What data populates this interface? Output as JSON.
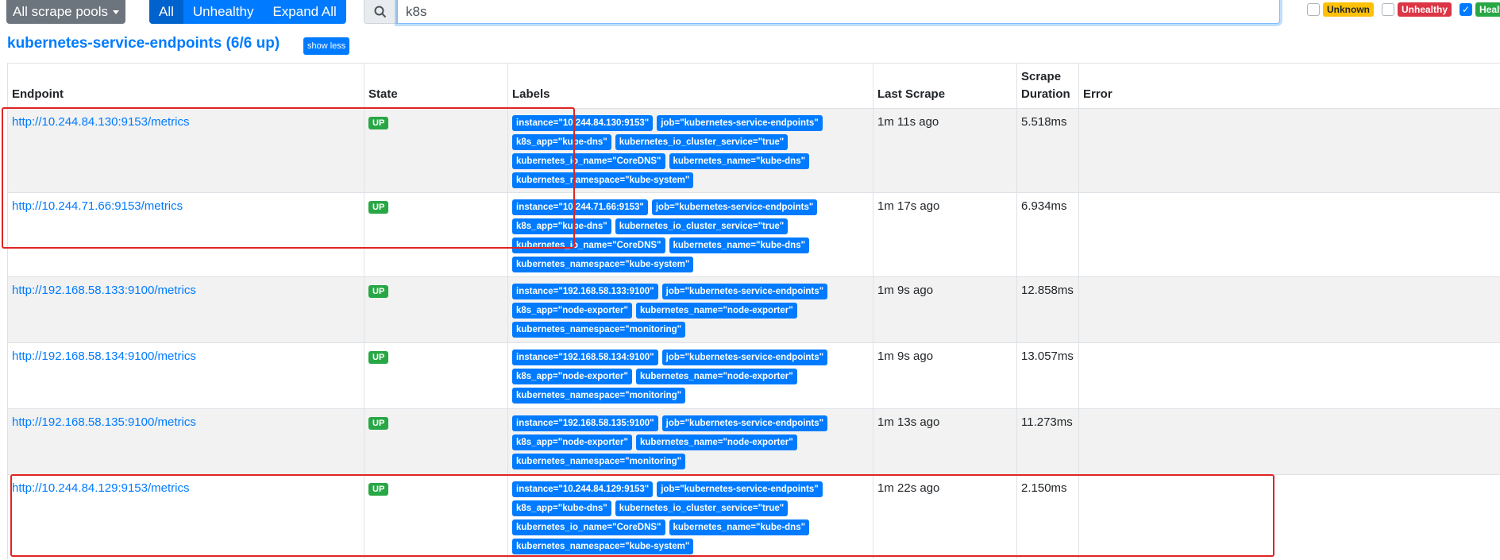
{
  "toolbar": {
    "pool_selector": "All scrape pools",
    "filter_all": "All",
    "filter_unhealthy": "Unhealthy",
    "expand_all": "Expand All",
    "search_value": "k8s"
  },
  "health_filters": {
    "unknown": "Unknown",
    "unhealthy": "Unhealthy",
    "healthy": "Healthy"
  },
  "pool": {
    "title": "kubernetes-service-endpoints (6/6 up)",
    "show_less": "show less"
  },
  "table": {
    "headers": {
      "endpoint": "Endpoint",
      "state": "State",
      "labels": "Labels",
      "last_scrape": "Last Scrape",
      "scrape_duration": "Scrape Duration",
      "error": "Error"
    },
    "rows": [
      {
        "endpoint": "http://10.244.84.130:9153/metrics",
        "state": "UP",
        "labels": [
          "instance=\"10.244.84.130:9153\"",
          "job=\"kubernetes-service-endpoints\"",
          "k8s_app=\"kube-dns\"",
          "kubernetes_io_cluster_service=\"true\"",
          "kubernetes_io_name=\"CoreDNS\"",
          "kubernetes_name=\"kube-dns\"",
          "kubernetes_namespace=\"kube-system\""
        ],
        "last_scrape": "1m 11s ago",
        "duration": "5.518ms",
        "error": ""
      },
      {
        "endpoint": "http://10.244.71.66:9153/metrics",
        "state": "UP",
        "labels": [
          "instance=\"10.244.71.66:9153\"",
          "job=\"kubernetes-service-endpoints\"",
          "k8s_app=\"kube-dns\"",
          "kubernetes_io_cluster_service=\"true\"",
          "kubernetes_io_name=\"CoreDNS\"",
          "kubernetes_name=\"kube-dns\"",
          "kubernetes_namespace=\"kube-system\""
        ],
        "last_scrape": "1m 17s ago",
        "duration": "6.934ms",
        "error": ""
      },
      {
        "endpoint": "http://192.168.58.133:9100/metrics",
        "state": "UP",
        "labels": [
          "instance=\"192.168.58.133:9100\"",
          "job=\"kubernetes-service-endpoints\"",
          "k8s_app=\"node-exporter\"",
          "kubernetes_name=\"node-exporter\"",
          "kubernetes_namespace=\"monitoring\""
        ],
        "last_scrape": "1m 9s ago",
        "duration": "12.858ms",
        "error": ""
      },
      {
        "endpoint": "http://192.168.58.134:9100/metrics",
        "state": "UP",
        "labels": [
          "instance=\"192.168.58.134:9100\"",
          "job=\"kubernetes-service-endpoints\"",
          "k8s_app=\"node-exporter\"",
          "kubernetes_name=\"node-exporter\"",
          "kubernetes_namespace=\"monitoring\""
        ],
        "last_scrape": "1m 9s ago",
        "duration": "13.057ms",
        "error": ""
      },
      {
        "endpoint": "http://192.168.58.135:9100/metrics",
        "state": "UP",
        "labels": [
          "instance=\"192.168.58.135:9100\"",
          "job=\"kubernetes-service-endpoints\"",
          "k8s_app=\"node-exporter\"",
          "kubernetes_name=\"node-exporter\"",
          "kubernetes_namespace=\"monitoring\""
        ],
        "last_scrape": "1m 13s ago",
        "duration": "11.273ms",
        "error": ""
      },
      {
        "endpoint": "http://10.244.84.129:9153/metrics",
        "state": "UP",
        "labels": [
          "instance=\"10.244.84.129:9153\"",
          "job=\"kubernetes-service-endpoints\"",
          "k8s_app=\"kube-dns\"",
          "kubernetes_io_cluster_service=\"true\"",
          "kubernetes_io_name=\"CoreDNS\"",
          "kubernetes_name=\"kube-dns\"",
          "kubernetes_namespace=\"kube-system\""
        ],
        "last_scrape": "1m 22s ago",
        "duration": "2.150ms",
        "error": ""
      }
    ]
  },
  "colors": {
    "primary": "#007bff",
    "success": "#28a745",
    "danger": "#dc3545",
    "warning": "#ffc107",
    "annotation": "#e02424"
  }
}
